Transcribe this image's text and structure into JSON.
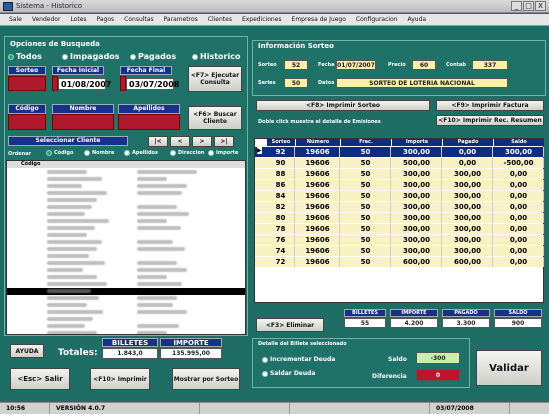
{
  "window": {
    "title": "Sistema - Historico",
    "min": "_",
    "max": "□",
    "close": "X"
  },
  "menu": [
    "Sale",
    "Vendedor",
    "Lotes",
    "Pagos",
    "Consultas",
    "Parametros",
    "Clientes",
    "Expediciones",
    "Empresa de Juego",
    "Configuracion",
    "Ayuda"
  ],
  "search": {
    "title": "Opciones de Busqueda",
    "radios": [
      "Todos",
      "Impagados",
      "Pagados",
      "Historico"
    ],
    "serie_label": "Sorteo",
    "fecha_inicial_label": "Fecha Inicial",
    "fecha_final_label": "Fecha Final",
    "fecha_inicial": "01/08/2007",
    "fecha_final": "03/07/2008",
    "consulta_btn": "<F7> Ejecutar Consulta",
    "codigo_label": "Código",
    "nombre_label": "Nombre",
    "apellidos_label": "Apellidos",
    "buscar_btn": "<F6> Buscar Cliente",
    "seleccionar_label": "Seleccionar Cliente",
    "ordenar_label": "Ordenar",
    "order_options": [
      "Código",
      "Nombre",
      "Apellidos",
      "Direccion",
      "Importe"
    ],
    "list_header_codigo": "Código",
    "list_codes": [
      "",
      "",
      "",
      "",
      "",
      "",
      "",
      "",
      "",
      "",
      "",
      "",
      "",
      "",
      "",
      "",
      "",
      "",
      "",
      "",
      "",
      "",
      "",
      "",
      ""
    ],
    "nav_buttons": [
      "|<",
      "<",
      ">",
      ">|"
    ]
  },
  "info": {
    "title": "Información Sorteo",
    "sorteo_label": "Sorteo",
    "sorteo": "52",
    "fecha_label": "Fecha",
    "fecha": "01/07/2007",
    "precio_label": "Precio",
    "precio": "60",
    "contab_label": "Contab",
    "contab": "337",
    "series_label": "Series",
    "series": "50",
    "datos_label": "Datos",
    "datos": "SORTEO DE LOTERIA NACIONAL",
    "imprimir_billetes": "<F8> Imprimir Sorteo",
    "imprimir_factura": "<F9> Imprimir Factura",
    "imprimir_recibo": "<F10> Imprimir Rec. Resumen",
    "hint": "Doble click muestra el detalle de Emisiones"
  },
  "table": {
    "headers": [
      "Sorteo",
      "Número",
      "Frac.",
      "Importe",
      "Pagado",
      "Saldo"
    ],
    "rows": [
      [
        "92",
        "19606",
        "50",
        "300,00",
        "0,00",
        "300,00"
      ],
      [
        "90",
        "19606",
        "50",
        "500,00",
        "0,00",
        "-500,00"
      ],
      [
        "88",
        "19606",
        "50",
        "300,00",
        "300,00",
        "0,00"
      ],
      [
        "86",
        "19606",
        "50",
        "300,00",
        "300,00",
        "0,00"
      ],
      [
        "84",
        "19606",
        "50",
        "300,00",
        "300,00",
        "0,00"
      ],
      [
        "82",
        "19606",
        "50",
        "300,00",
        "300,00",
        "0,00"
      ],
      [
        "80",
        "19606",
        "50",
        "300,00",
        "300,00",
        "0,00"
      ],
      [
        "78",
        "19606",
        "50",
        "300,00",
        "300,00",
        "0,00"
      ],
      [
        "76",
        "19606",
        "50",
        "300,00",
        "300,00",
        "0,00"
      ],
      [
        "74",
        "19606",
        "50",
        "300,00",
        "300,00",
        "0,00"
      ],
      [
        "72",
        "19606",
        "50",
        "600,00",
        "600,00",
        "0,00"
      ]
    ]
  },
  "summary": {
    "eliminar_btn": "<F3> Eliminar",
    "headers": [
      "BILLETES",
      "IMPORTE",
      "PAGADO",
      "SALDO"
    ],
    "values": [
      "55",
      "4.200",
      "3.300",
      "900"
    ]
  },
  "detalle": {
    "title": "Detalle del Billete seleccionado",
    "opt1": "Incrementar Deuda",
    "opt2": "Saldar Deuda",
    "saldo_label": "Saldo",
    "saldo": "-300",
    "diferencia_label": "Diferencia",
    "diferencia": "0",
    "validar": "Validar"
  },
  "totals": {
    "ayuda_btn": "AYUDA",
    "label": "Totales:",
    "billetes_label": "BILLETES",
    "importe_label": "IMPORTE",
    "billetes": "1.843,0",
    "importe": "135.995,00"
  },
  "bottom": {
    "salir": "<Esc> Salir",
    "imprimir": "<F10> Imprimir",
    "mostrar": "Mostrar por Sorteo"
  },
  "status": [
    "10:56",
    "VERSIÓN 4.0.7",
    "",
    "",
    "03/07/2008"
  ],
  "colors": {
    "bg": "#1e6e66",
    "header": "#17318a",
    "red": "#b0182e"
  }
}
